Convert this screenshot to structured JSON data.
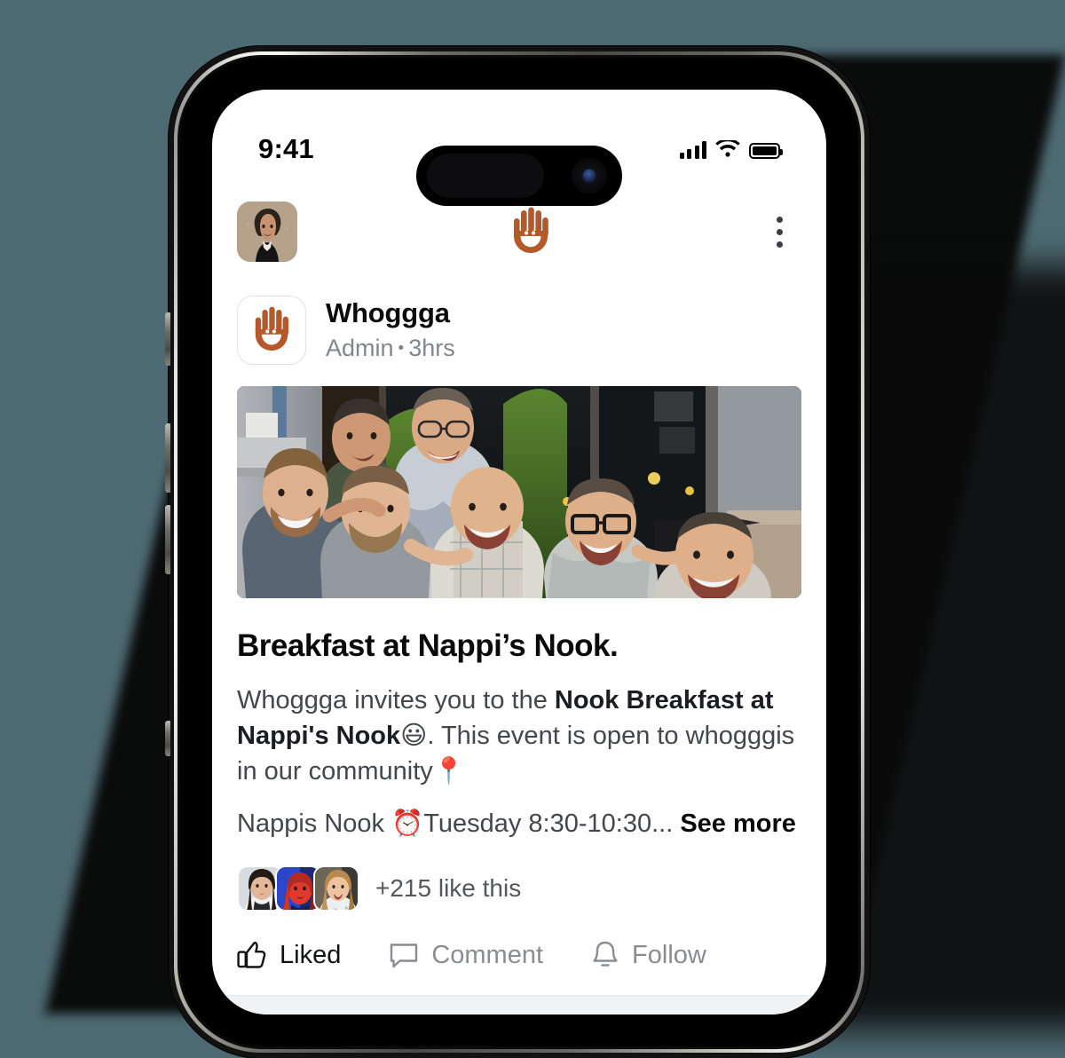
{
  "theme": {
    "background": "#4d6a72",
    "brand_orange": "#b3592a",
    "screen_bg": "#ffffff",
    "text_primary": "#0a0a0b",
    "text_secondary": "#84868c",
    "body_text": "#44464c"
  },
  "status_bar": {
    "time": "9:41",
    "signal_icon": "cellular-bars-icon",
    "signal_bars": 4,
    "wifi_icon": "wifi-icon",
    "battery_icon": "battery-full-icon"
  },
  "app_header": {
    "avatar": "user-avatar",
    "logo_icon": "whoggga-hand-logo",
    "menu_icon": "kebab-menu-icon"
  },
  "post": {
    "author": "Whoggga",
    "role": "Admin",
    "separator": "•",
    "timestamp": "3hrs",
    "brand_icon": "whoggga-hand-logo",
    "photo_alt": "group-photo",
    "title": "Breakfast at Nappi’s Nook.",
    "body": {
      "part1": "Whoggga invites you to the ",
      "bold1": "Nook Breakfast at Nappi's Nook",
      "emoji1": "😃",
      "part2": ". This event is open to whogggis in our community",
      "emoji2": "📍"
    },
    "detail_line": {
      "place": "Nappis Nook ",
      "emoji": "⏰",
      "schedule": "Tuesday 8:30-10:30...",
      "see_more": "See more"
    },
    "likes": {
      "count_label": "+215 like this",
      "avatars": [
        "liker-avatar-1",
        "liker-avatar-2",
        "liker-avatar-3"
      ]
    },
    "actions": [
      {
        "id": "like",
        "label": "Liked",
        "icon": "thumbs-up-icon",
        "state": "active"
      },
      {
        "id": "comment",
        "label": "Comment",
        "icon": "comment-bubble-icon",
        "state": "muted"
      },
      {
        "id": "follow",
        "label": "Follow",
        "icon": "bell-icon",
        "state": "muted"
      }
    ]
  }
}
